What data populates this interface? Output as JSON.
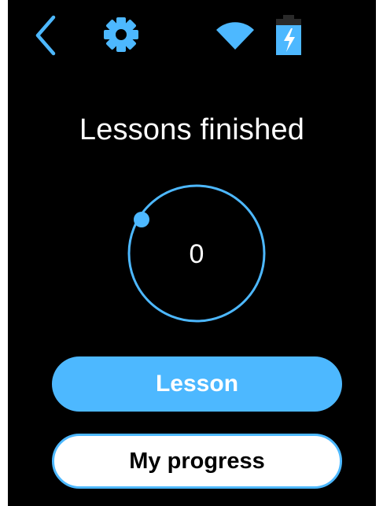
{
  "header": {
    "icons": {
      "back": "chevron-left-icon",
      "settings": "gear-icon",
      "wifi": "wifi-icon",
      "battery": "battery-charging-icon"
    }
  },
  "main": {
    "title": "Lessons finished",
    "count": "0",
    "progress": 0
  },
  "actions": {
    "lesson_label": "Lesson",
    "progress_label": "My progress"
  },
  "colors": {
    "background": "#000000",
    "accent": "#4db8ff",
    "text": "#ffffff",
    "outline_button_fill": "#ffffff",
    "outline_button_text": "#000000"
  }
}
